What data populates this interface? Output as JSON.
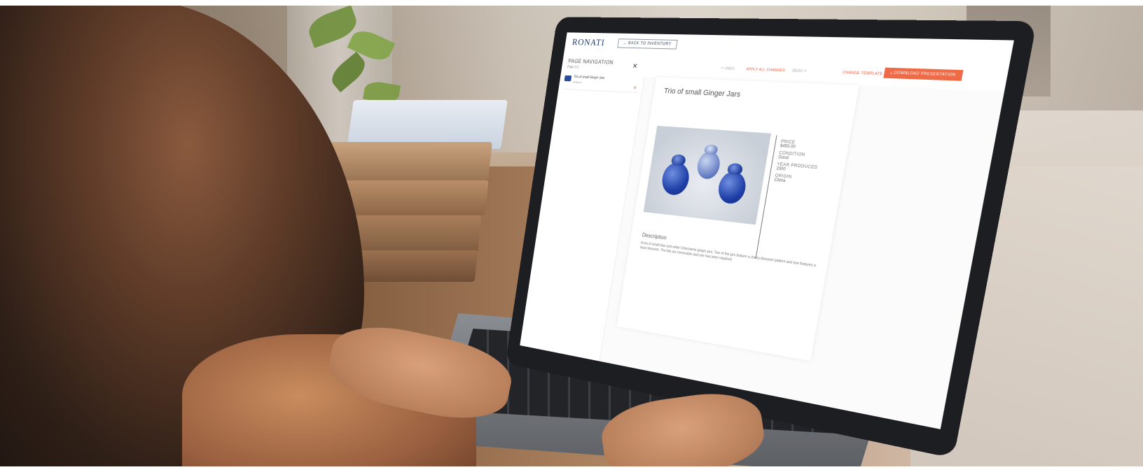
{
  "app": {
    "logo": "RONATI",
    "back_button": "← BACK TO INVENTORY"
  },
  "sidebar": {
    "title": "PAGE NAVIGATION",
    "subtitle": "Page 1/1",
    "collapse_icon": "collapse-icon",
    "items": [
      {
        "title": "Trio of small Ginger Jars",
        "subtitle": "Antiques",
        "remove_icon": "remove-icon"
      }
    ]
  },
  "toolbar": {
    "undo": "↶ UNDO",
    "apply": "APPLY ALL CHANGES",
    "redo": "REDO ↷",
    "save": "CHANGE TEMPLATE",
    "download": "⤓ DOWNLOAD PRESENTATION"
  },
  "page": {
    "title": "Trio of small Ginger Jars",
    "attributes": [
      {
        "label": "PRICE",
        "value": "$450.00"
      },
      {
        "label": "CONDITION",
        "value": "Good"
      },
      {
        "label": "YEAR PRODUCED",
        "value": "2000"
      },
      {
        "label": "ORIGIN",
        "value": "China"
      }
    ],
    "description_heading": "Description",
    "description_text": "A trio of small blue and white Chinoiserie ginger jars. Two of the jars feature a cherry blossom pattern and one features a lotus blossom. The lids are removable and one has been repaired."
  },
  "colors": {
    "accent": "#ef6a47",
    "brand": "#223a66",
    "jar_blue": "#1f3fa8"
  }
}
